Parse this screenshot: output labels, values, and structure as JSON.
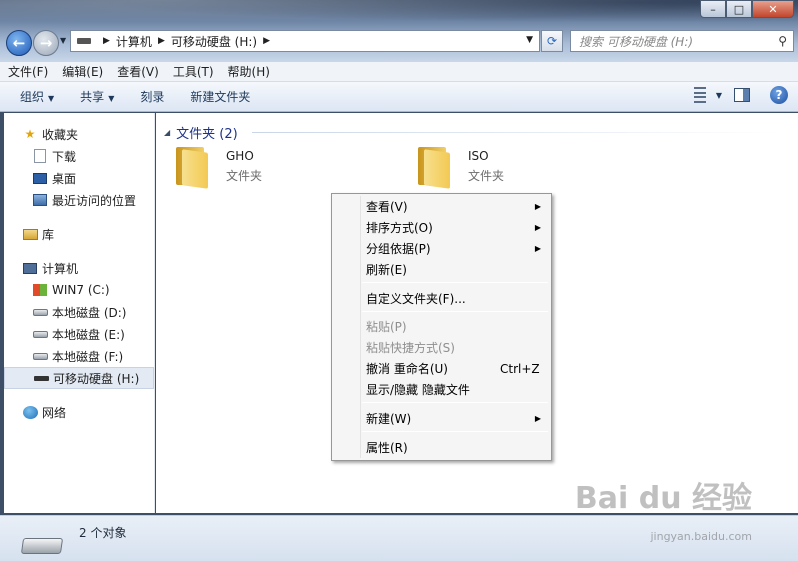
{
  "window": {
    "controls": {
      "minimize": "–",
      "maximize": "□",
      "close": "✕"
    }
  },
  "address": {
    "segments": [
      "计算机",
      "可移动硬盘 (H:)"
    ],
    "refresh_glyph": "⟳"
  },
  "search": {
    "placeholder": "搜索 可移动硬盘 (H:)",
    "icon": "search-icon"
  },
  "menubar": [
    "文件(F)",
    "编辑(E)",
    "查看(V)",
    "工具(T)",
    "帮助(H)"
  ],
  "toolbar": {
    "organize": "组织",
    "share": "共享",
    "burn": "刻录",
    "new_folder": "新建文件夹",
    "help": "?"
  },
  "sidebar": {
    "favorites": "收藏夹",
    "downloads": "下载",
    "desktop": "桌面",
    "recent": "最近访问的位置",
    "libraries": "库",
    "computer": "计算机",
    "drives": [
      "WIN7 (C:)",
      "本地磁盘 (D:)",
      "本地磁盘 (E:)",
      "本地磁盘 (F:)",
      "可移动硬盘 (H:)"
    ],
    "network": "网络"
  },
  "content": {
    "group_title": "文件夹 (2)",
    "folders": [
      {
        "name": "GHO",
        "type": "文件夹"
      },
      {
        "name": "ISO",
        "type": "文件夹"
      }
    ]
  },
  "context_menu": {
    "view": "查看(V)",
    "sort_by": "排序方式(O)",
    "group_by": "分组依据(P)",
    "refresh": "刷新(E)",
    "customize": "自定义文件夹(F)...",
    "paste": "粘贴(P)",
    "paste_shortcut": "粘贴快捷方式(S)",
    "undo_rename": "撤消 重命名(U)",
    "undo_shortcut": "Ctrl+Z",
    "show_hidden": "显示/隐藏 隐藏文件",
    "new": "新建(W)",
    "properties": "属性(R)"
  },
  "status": {
    "count": "2 个对象"
  },
  "watermark": {
    "main": "Bai du 经验",
    "sub": "jingyan.baidu.com"
  }
}
